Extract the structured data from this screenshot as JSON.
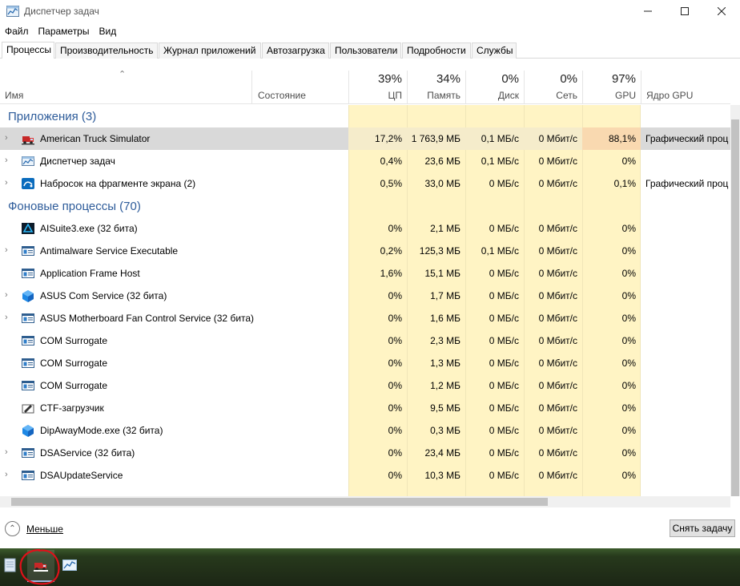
{
  "window": {
    "title": "Диспетчер задач",
    "controls": [
      "minimize-icon",
      "maximize-icon",
      "close-icon"
    ]
  },
  "menu": [
    "Файл",
    "Параметры",
    "Вид"
  ],
  "tabs": [
    "Процессы",
    "Производительность",
    "Журнал приложений",
    "Автозагрузка",
    "Пользователи",
    "Подробности",
    "Службы"
  ],
  "active_tab": "Процессы",
  "columns": {
    "name": "Имя",
    "status": "Состояние",
    "cpu": {
      "pct": "39%",
      "label": "ЦП"
    },
    "memory": {
      "pct": "34%",
      "label": "Память"
    },
    "disk": {
      "pct": "0%",
      "label": "Диск"
    },
    "network": {
      "pct": "0%",
      "label": "Сеть"
    },
    "gpu": {
      "pct": "97%",
      "label": "GPU"
    },
    "gpu_engine": "Ядро GPU"
  },
  "groups": [
    {
      "title": "Приложения (3)"
    },
    {
      "title": "Фоновые процессы (70)"
    }
  ],
  "rows": [
    {
      "kind": "group",
      "group": 0
    },
    {
      "kind": "proc",
      "expand": true,
      "icon": "truck-icon",
      "name": "American Truck Simulator",
      "cpu": "17,2%",
      "mem": "1 763,9 МБ",
      "disk": "0,1 МБ/с",
      "net": "0 Мбит/с",
      "gpu": "88,1%",
      "engine": "Графический проц",
      "selected": true
    },
    {
      "kind": "proc",
      "expand": true,
      "icon": "task-manager-icon",
      "name": "Диспетчер задач",
      "cpu": "0,4%",
      "mem": "23,6 МБ",
      "disk": "0,1 МБ/с",
      "net": "0 Мбит/с",
      "gpu": "0%",
      "engine": ""
    },
    {
      "kind": "proc",
      "expand": true,
      "icon": "snip-sketch-icon",
      "name": "Набросок на фрагменте экрана (2)",
      "cpu": "0,5%",
      "mem": "33,0 МБ",
      "disk": "0 МБ/с",
      "net": "0 Мбит/с",
      "gpu": "0,1%",
      "engine": "Графический проц"
    },
    {
      "kind": "group",
      "group": 1
    },
    {
      "kind": "proc",
      "expand": false,
      "icon": "aisuite-icon",
      "name": "AISuite3.exe (32 бита)",
      "cpu": "0%",
      "mem": "2,1 МБ",
      "disk": "0 МБ/с",
      "net": "0 Мбит/с",
      "gpu": "0%",
      "engine": ""
    },
    {
      "kind": "proc",
      "expand": true,
      "icon": "service-window-icon",
      "name": "Antimalware Service Executable",
      "cpu": "0,2%",
      "mem": "125,3 МБ",
      "disk": "0,1 МБ/с",
      "net": "0 Мбит/с",
      "gpu": "0%",
      "engine": ""
    },
    {
      "kind": "proc",
      "expand": false,
      "icon": "service-window-icon",
      "name": "Application Frame Host",
      "cpu": "1,6%",
      "mem": "15,1 МБ",
      "disk": "0 МБ/с",
      "net": "0 Мбит/с",
      "gpu": "0%",
      "engine": ""
    },
    {
      "kind": "proc",
      "expand": true,
      "icon": "asus-cube-icon",
      "name": "ASUS Com Service (32 бита)",
      "cpu": "0%",
      "mem": "1,7 МБ",
      "disk": "0 МБ/с",
      "net": "0 Мбит/с",
      "gpu": "0%",
      "engine": ""
    },
    {
      "kind": "proc",
      "expand": true,
      "icon": "service-window-icon",
      "name": "ASUS Motherboard Fan Control Service (32 бита)",
      "cpu": "0%",
      "mem": "1,6 МБ",
      "disk": "0 МБ/с",
      "net": "0 Мбит/с",
      "gpu": "0%",
      "engine": ""
    },
    {
      "kind": "proc",
      "expand": false,
      "icon": "service-window-icon",
      "name": "COM Surrogate",
      "cpu": "0%",
      "mem": "2,3 МБ",
      "disk": "0 МБ/с",
      "net": "0 Мбит/с",
      "gpu": "0%",
      "engine": ""
    },
    {
      "kind": "proc",
      "expand": false,
      "icon": "service-window-icon",
      "name": "COM Surrogate",
      "cpu": "0%",
      "mem": "1,3 МБ",
      "disk": "0 МБ/с",
      "net": "0 Мбит/с",
      "gpu": "0%",
      "engine": ""
    },
    {
      "kind": "proc",
      "expand": false,
      "icon": "service-window-icon",
      "name": "COM Surrogate",
      "cpu": "0%",
      "mem": "1,2 МБ",
      "disk": "0 МБ/с",
      "net": "0 Мбит/с",
      "gpu": "0%",
      "engine": ""
    },
    {
      "kind": "proc",
      "expand": false,
      "icon": "ctf-loader-icon",
      "name": "CTF-загрузчик",
      "cpu": "0%",
      "mem": "9,5 МБ",
      "disk": "0 МБ/с",
      "net": "0 Мбит/с",
      "gpu": "0%",
      "engine": ""
    },
    {
      "kind": "proc",
      "expand": false,
      "icon": "asus-cube-icon",
      "name": "DipAwayMode.exe (32 бита)",
      "cpu": "0%",
      "mem": "0,3 МБ",
      "disk": "0 МБ/с",
      "net": "0 Мбит/с",
      "gpu": "0%",
      "engine": ""
    },
    {
      "kind": "proc",
      "expand": true,
      "icon": "service-window-icon",
      "name": "DSAService (32 бита)",
      "cpu": "0%",
      "mem": "23,4 МБ",
      "disk": "0 МБ/с",
      "net": "0 Мбит/с",
      "gpu": "0%",
      "engine": ""
    },
    {
      "kind": "proc",
      "expand": true,
      "icon": "service-window-icon",
      "name": "DSAUpdateService",
      "cpu": "0%",
      "mem": "10,3 МБ",
      "disk": "0 МБ/с",
      "net": "0 Мбит/с",
      "gpu": "0%",
      "engine": ""
    }
  ],
  "footer": {
    "less_label": "Меньше",
    "end_task_label": "Снять задачу"
  },
  "taskbar": [
    "notepad-icon",
    "truck-icon",
    "task-manager-icon"
  ],
  "colors": {
    "group_title": "#2e5c9a",
    "heat_light": "#fff4c4",
    "heat_medium": "#ffefb0",
    "heat_gpu": "#f9d9b0",
    "selected": "#d9d9d9"
  }
}
